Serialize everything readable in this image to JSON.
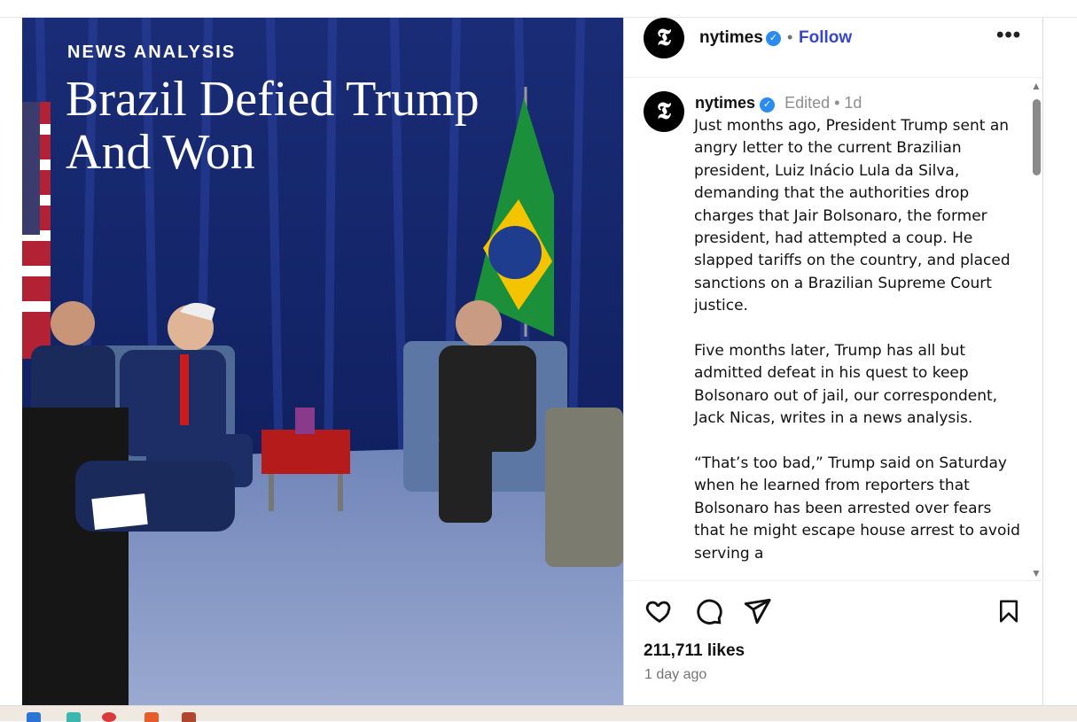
{
  "post": {
    "kicker": "NEWS ANALYSIS",
    "headline": "Brazil Defied Trump And Won"
  },
  "header": {
    "avatar_glyph": "𝕿",
    "username": "nytimes",
    "separator": "•",
    "follow_label": "Follow",
    "more_label": "•••"
  },
  "caption": {
    "username": "nytimes",
    "meta": "Edited •  1d",
    "paragraphs": [
      "Just months ago, President Trump sent an angry letter to the current Brazilian president, Luiz Inácio Lula da Silva, demanding that the authorities drop charges that Jair Bolsonaro, the former president, had attempted a coup. He slapped tariffs on the country, and placed sanctions on a Brazilian Supreme Court justice.",
      "Five months later, Trump has all but admitted defeat in his quest to keep Bolsonaro out of jail, our correspondent, Jack Nicas, writes in a news analysis.",
      "“That’s too bad,” Trump said on Saturday when he learned from reporters that Bolsonaro has been arrested over fears that he might escape house arrest to avoid serving a"
    ]
  },
  "actions": {
    "like_icon": "heart-icon",
    "comment_icon": "comment-icon",
    "share_icon": "share-icon",
    "save_icon": "bookmark-icon"
  },
  "likes": "211,711 likes",
  "timestamp": "1 day ago",
  "colors": {
    "follow": "#3546c8",
    "verified": "#2b8cf0",
    "curtain": "#1b2f7a"
  }
}
